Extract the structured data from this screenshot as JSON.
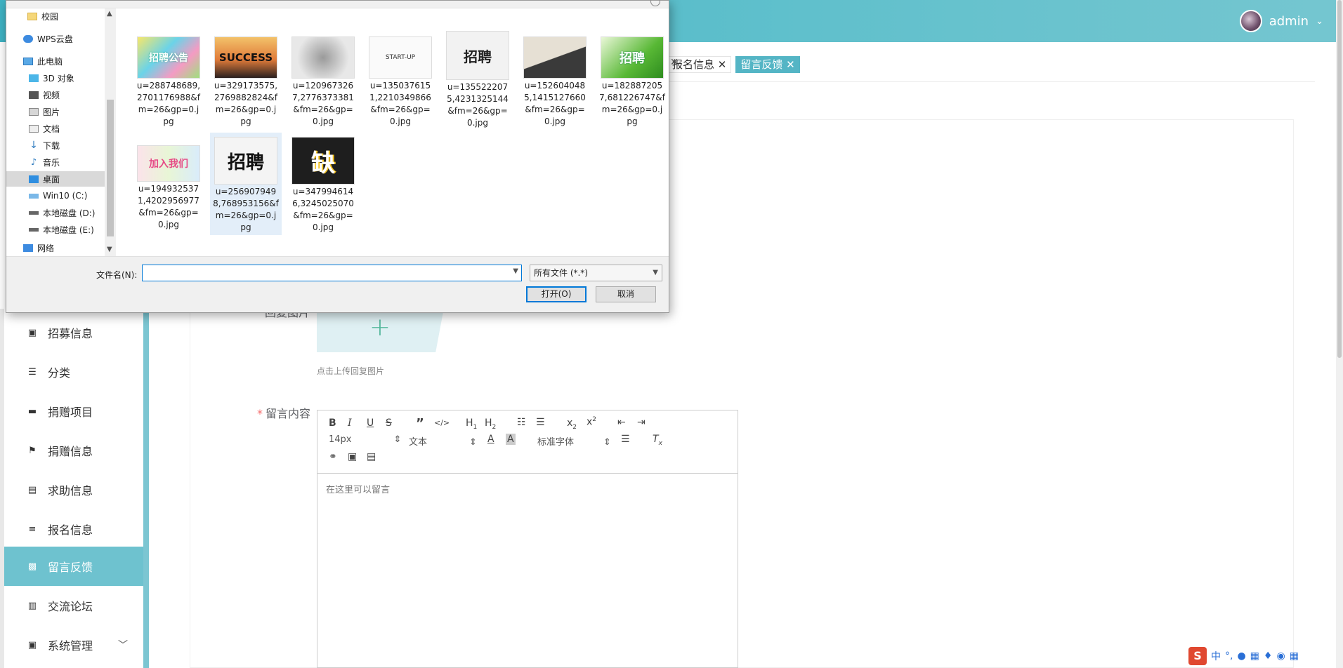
{
  "app": {
    "user": "admin",
    "tags": [
      "报名信息",
      "留言反馈"
    ],
    "active_tag": "留言反馈"
  },
  "sidebar": {
    "items": [
      {
        "label": "招募信息",
        "icon": "doc-icon"
      },
      {
        "label": "分类",
        "icon": "sliders-icon"
      },
      {
        "label": "捐赠项目",
        "icon": "flag-icon"
      },
      {
        "label": "捐赠信息",
        "icon": "flag-icon"
      },
      {
        "label": "求助信息",
        "icon": "clipboard-icon"
      },
      {
        "label": "报名信息",
        "icon": "list-icon"
      },
      {
        "label": "留言反馈",
        "icon": "chat-icon"
      },
      {
        "label": "交流论坛",
        "icon": "bar-chart-icon"
      },
      {
        "label": "系统管理",
        "icon": "clipboard-check-icon"
      }
    ],
    "active": "留言反馈"
  },
  "form": {
    "reply_image_label": "回复图片",
    "reply_image_tip": "点击上传回复图片",
    "content_label": "留言内容",
    "editor": {
      "font_size": "14px",
      "block_type": "文本",
      "font_family": "标准字体",
      "placeholder": "在这里可以留言"
    }
  },
  "dialog": {
    "nav_items": [
      {
        "label": "校园",
        "icon": "folder-icon"
      },
      {
        "label": "WPS云盘",
        "icon": "cloud-icon"
      },
      {
        "label": "此电脑",
        "icon": "computer-icon"
      },
      {
        "label": "3D 对象",
        "icon": "cube-icon"
      },
      {
        "label": "视频",
        "icon": "video-icon"
      },
      {
        "label": "图片",
        "icon": "picture-icon"
      },
      {
        "label": "文档",
        "icon": "document-icon"
      },
      {
        "label": "下载",
        "icon": "download-icon"
      },
      {
        "label": "音乐",
        "icon": "music-icon"
      },
      {
        "label": "桌面",
        "icon": "desktop-icon"
      },
      {
        "label": "Win10 (C:)",
        "icon": "drive-icon"
      },
      {
        "label": "本地磁盘 (D:)",
        "icon": "drive-icon"
      },
      {
        "label": "本地磁盘 (E:)",
        "icon": "drive-icon"
      },
      {
        "label": "网络",
        "icon": "network-icon"
      }
    ],
    "selected_nav": "桌面",
    "files": [
      {
        "name": "u=288748689,2701176988&fm=26&gp=0.jpg",
        "thumb_text": "招聘公告",
        "thumb_style": "colorful"
      },
      {
        "name": "u=329173575,2769882824&fm=26&gp=0.jpg",
        "thumb_text": "SUCCESS",
        "thumb_style": "sunset"
      },
      {
        "name": "u=1209673267,2776373381&fm=26&gp=0.jpg",
        "thumb_text": "",
        "thumb_style": "grey"
      },
      {
        "name": "u=1350376151,2210349866&fm=26&gp=0.jpg",
        "thumb_text": "START-UP",
        "thumb_style": "white"
      },
      {
        "name": "u=1355222075,4231325144&fm=26&gp=0.jpg",
        "thumb_text": "招聘",
        "thumb_style": "ink"
      },
      {
        "name": "u=1526040485,1415127660&fm=26&gp=0.jpg",
        "thumb_text": "",
        "thumb_style": "arrow"
      },
      {
        "name": "u=1828872057,681226747&fm=26&gp=0.jpg",
        "thumb_text": "招聘",
        "thumb_style": "green"
      },
      {
        "name": "u=1949325371,4202956977&fm=26&gp=0.jpg",
        "thumb_text": "加入我们",
        "thumb_style": "pastel"
      },
      {
        "name": "u=2569079498,768953156&fm=26&gp=0.jpg",
        "thumb_text": "招聘",
        "thumb_style": "calligraphy"
      },
      {
        "name": "u=3479946146,3245025070&fm=26&gp=0.jpg",
        "thumb_text": "缺",
        "thumb_style": "dark"
      }
    ],
    "selected_file_index": 8,
    "filename_label": "文件名(N):",
    "filename_value": "",
    "filetype": "所有文件 (*.*)",
    "open_button": "打开(O)",
    "cancel_button": "取消"
  },
  "ime": {
    "label": "中"
  }
}
